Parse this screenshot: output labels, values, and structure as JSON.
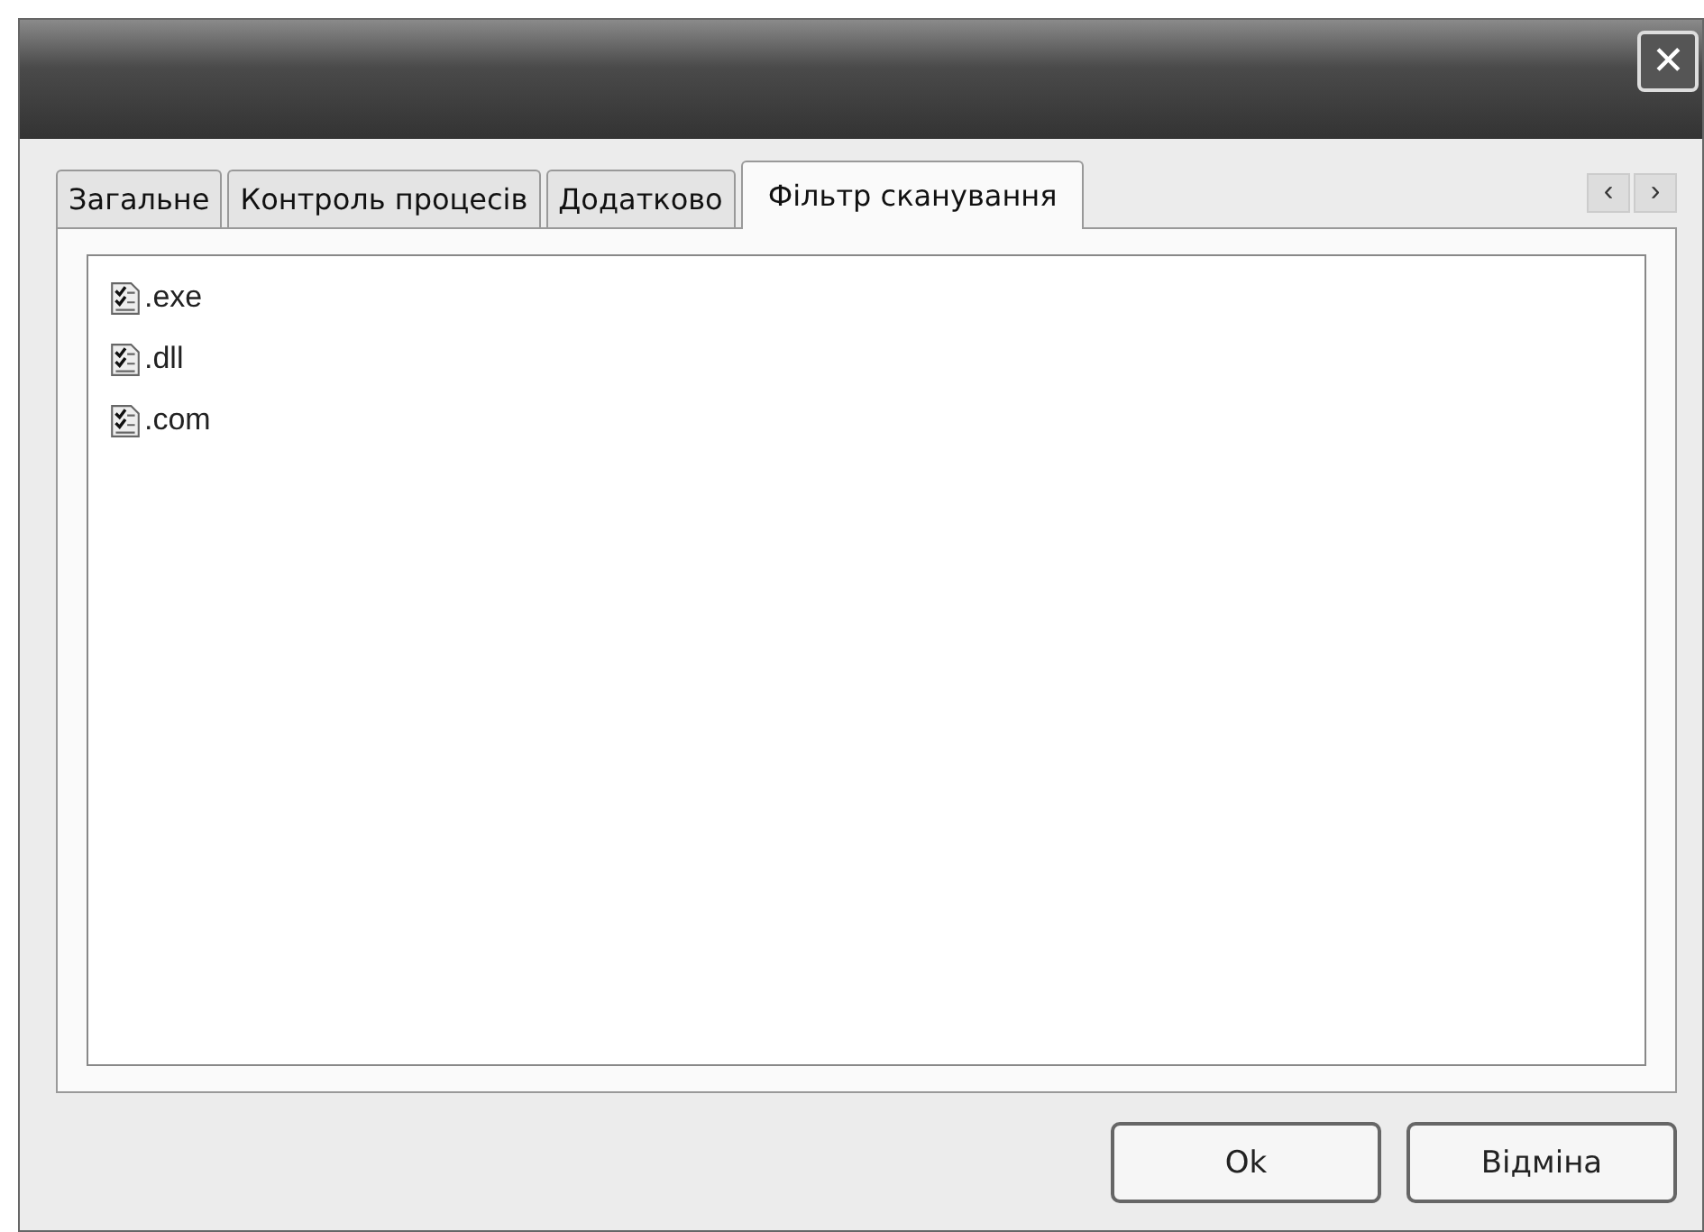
{
  "window": {
    "close_glyph": "✕"
  },
  "tabs": [
    {
      "label": "Загальне",
      "selected": false
    },
    {
      "label": "Контроль процесів",
      "selected": false
    },
    {
      "label": "Додатково",
      "selected": false
    },
    {
      "label": "Фільтр сканування",
      "selected": true
    }
  ],
  "tab_scroll": [
    "‹",
    "›"
  ],
  "items": [
    {
      "label": ".exe"
    },
    {
      "label": ".dll"
    },
    {
      "label": ".com"
    }
  ],
  "buttons": [
    "Ok",
    "Відміна"
  ]
}
